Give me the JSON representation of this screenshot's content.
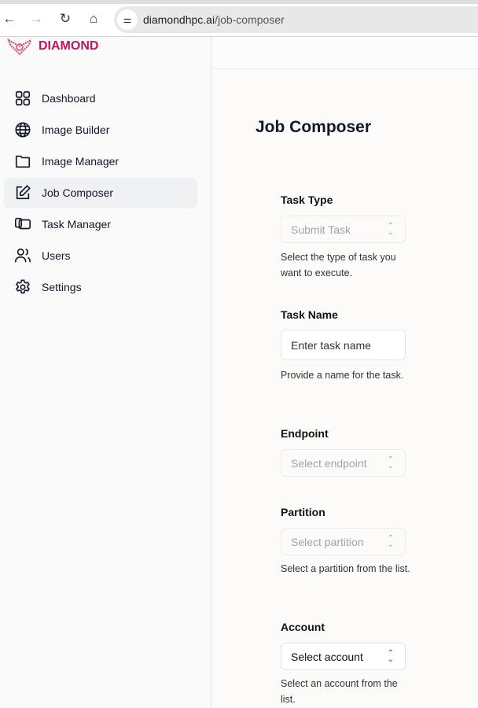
{
  "browser": {
    "url_host": "diamondhpc.ai",
    "url_path": "/job-composer",
    "icons": [
      "back-icon",
      "forward-icon",
      "reload-icon",
      "home-icon",
      "site-settings-icon"
    ]
  },
  "sidebar": {
    "brand": "DIAMOND",
    "brand_color": "#c0135f",
    "active": "Job Composer",
    "items": [
      {
        "label": "Dashboard",
        "icon": "grid-icon"
      },
      {
        "label": "Image Builder",
        "icon": "globe-icon"
      },
      {
        "label": "Image Manager",
        "icon": "folder-icon"
      },
      {
        "label": "Job Composer",
        "icon": "edit-icon"
      },
      {
        "label": "Task Manager",
        "icon": "windows-icon"
      },
      {
        "label": "Users",
        "icon": "users-icon"
      },
      {
        "label": "Settings",
        "icon": "gear-icon"
      }
    ]
  },
  "main": {
    "title": "Job Composer",
    "form": {
      "task_type": {
        "label": "Task Type",
        "value": "Submit Task",
        "help": "Select the type of task you want to execute."
      },
      "task_name": {
        "label": "Task Name",
        "placeholder": "Enter task name",
        "help": "Provide a name for the task."
      },
      "endpoint": {
        "label": "Endpoint",
        "placeholder": "Select endpoint"
      },
      "partition": {
        "label": "Partition",
        "placeholder": "Select partition",
        "help": "Select a partition from the list."
      },
      "account": {
        "label": "Account",
        "value": "Select account",
        "help": "Select an account from the list."
      }
    }
  }
}
